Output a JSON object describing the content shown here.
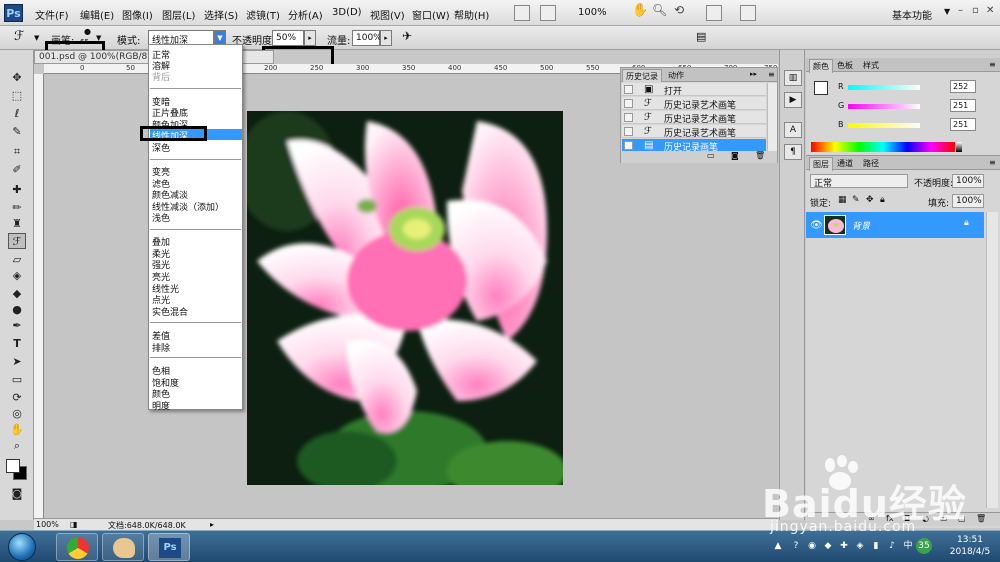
{
  "app": {
    "logo": "Ps",
    "title": "Adobe Photoshop"
  },
  "menu": [
    "文件(F)",
    "编辑(E)",
    "图像(I)",
    "图层(L)",
    "选择(S)",
    "滤镜(T)",
    "分析(A)",
    "3D(D)",
    "视图(V)",
    "窗口(W)",
    "帮助(H)"
  ],
  "appbar": {
    "zoom": "100%",
    "workspace": "基本功能"
  },
  "options": {
    "brush_label": "画笔:",
    "brush_size": "65",
    "mode_label": "模式:",
    "mode_value": "线性加深",
    "opacity_label": "不透明度:",
    "opacity_value": "50%",
    "flow_label": "流量:",
    "flow_value": "100%"
  },
  "document": {
    "tab": "001.psd @ 100%(RGB/8#) *",
    "ruler_numbers": [
      "0",
      "50",
      "100",
      "150",
      "200",
      "250",
      "300",
      "350",
      "400",
      "450",
      "500",
      "550",
      "600",
      "650",
      "700",
      "750"
    ],
    "zoom": "100%",
    "docsize": "文档:648.0K/648.0K"
  },
  "blend_modes": {
    "groups": [
      [
        "正常",
        "溶解",
        "背后"
      ],
      [
        "变暗",
        "正片叠底",
        "颜色加深",
        "线性加深",
        "深色"
      ],
      [
        "变亮",
        "滤色",
        "颜色减淡",
        "线性减淡（添加）",
        "浅色"
      ],
      [
        "叠加",
        "柔光",
        "强光",
        "亮光",
        "线性光",
        "点光",
        "实色混合"
      ],
      [
        "差值",
        "排除"
      ],
      [
        "色相",
        "饱和度",
        "颜色",
        "明度"
      ]
    ],
    "selected": "线性加深",
    "disabled": [
      "背后"
    ]
  },
  "history": {
    "tabs": [
      "历史记录",
      "动作"
    ],
    "items": [
      {
        "icon": "open-icon",
        "label": "打开"
      },
      {
        "icon": "art-history-brush-icon",
        "label": "历史记录艺术画笔"
      },
      {
        "icon": "art-history-brush-icon",
        "label": "历史记录艺术画笔"
      },
      {
        "icon": "art-history-brush-icon",
        "label": "历史记录艺术画笔"
      },
      {
        "icon": "history-brush-icon",
        "label": "历史记录画笔",
        "selected": true
      }
    ]
  },
  "color_panel": {
    "tabs": [
      "颜色",
      "色板",
      "样式"
    ],
    "channels": [
      {
        "name": "R",
        "value": "252",
        "color": "#fcfbfb"
      },
      {
        "name": "G",
        "value": "251",
        "color": "#fcfbfb"
      },
      {
        "name": "B",
        "value": "251",
        "color": "#fcfbfb"
      }
    ]
  },
  "layers_panel": {
    "tabs": [
      "图层",
      "通道",
      "路径"
    ],
    "blend": "正常",
    "opacity_label": "不透明度:",
    "opacity": "100%",
    "lock_label": "锁定:",
    "fill_label": "填充:",
    "fill": "100%",
    "layers": [
      {
        "name": "背景",
        "locked": true
      }
    ]
  },
  "taskbar": {
    "time": "13:51",
    "date": "2018/4/5",
    "badge": "35"
  },
  "watermark": {
    "brand": "Baidu经验",
    "url": "jingyan.baidu.com"
  },
  "colors": {
    "accent": "#3399ff",
    "canvas_bg": "#0d1f0f"
  }
}
